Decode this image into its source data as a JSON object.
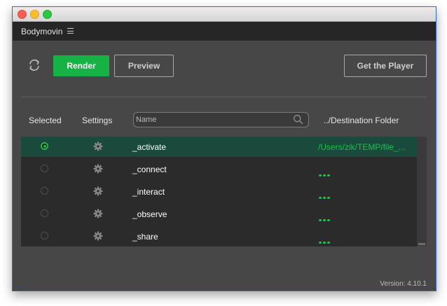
{
  "app": {
    "panel_title": "Bodymovin",
    "version": "Version: 4.10.1"
  },
  "toolbar": {
    "render_label": "Render",
    "preview_label": "Preview",
    "player_label": "Get the Player"
  },
  "table": {
    "headers": {
      "selected": "Selected",
      "settings": "Settings",
      "destination": "../Destination Folder"
    },
    "search": {
      "placeholder": "Name",
      "value": ""
    },
    "rows": [
      {
        "name": "_activate",
        "destination": "/Users/zik/TEMP/file_...",
        "selected": true
      },
      {
        "name": "_connect",
        "destination": "",
        "selected": false
      },
      {
        "name": "_interact",
        "destination": "",
        "selected": false
      },
      {
        "name": "_observe",
        "destination": "",
        "selected": false
      },
      {
        "name": "_share",
        "destination": "",
        "selected": false
      }
    ]
  },
  "colors": {
    "accent_green": "#17b245",
    "selected_row": "#194a3b",
    "panel_bg": "#474747",
    "list_bg": "#2b2b2b"
  },
  "icons": {
    "refresh": "refresh-icon",
    "menu": "hamburger-menu-icon",
    "settings": "gear-icon",
    "search": "search-icon"
  }
}
